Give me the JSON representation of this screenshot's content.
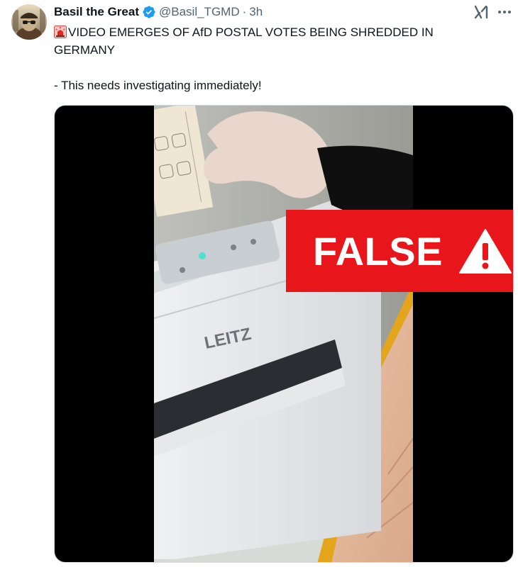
{
  "post": {
    "author": {
      "display_name": "Basil the Great",
      "handle": "@Basil_TGMD",
      "verified": true
    },
    "separator": "·",
    "timestamp": "3h",
    "text_lines": [
      "VIDEO EMERGES OF AfD POSTAL VOTES BEING SHREDDED IN",
      "GERMANY",
      "- This needs investigating immediately!"
    ],
    "emoji": "police-car-light",
    "media": {
      "type": "video",
      "shredder_brand": "LEITZ",
      "overlay": {
        "label": "FALSE",
        "icon": "warning-icon",
        "color": "#e8151b"
      }
    }
  },
  "icons": {
    "verified": "verified-badge-icon",
    "grok": "grok-icon",
    "more": "more-options-icon"
  },
  "colors": {
    "text": "#0f1419",
    "secondary": "#536471",
    "verified": "#1d9bf0",
    "overlay": "#e8151b"
  }
}
